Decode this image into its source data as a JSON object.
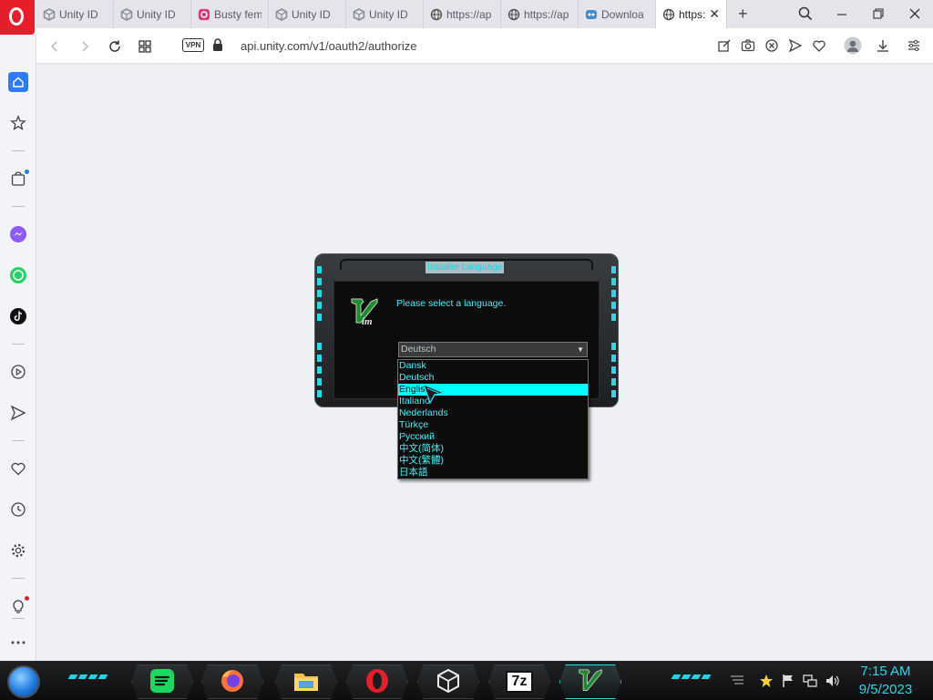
{
  "browser": {
    "tabs": [
      {
        "label": "Unity ID",
        "icon": "unity-icon"
      },
      {
        "label": "Unity ID",
        "icon": "unity-icon"
      },
      {
        "label": "Busty fem",
        "icon": "pink-app-icon"
      },
      {
        "label": "Unity ID",
        "icon": "unity-icon"
      },
      {
        "label": "Unity ID",
        "icon": "unity-icon"
      },
      {
        "label": "https://ap",
        "icon": "globe-icon"
      },
      {
        "label": "https://ap",
        "icon": "globe-icon"
      },
      {
        "label": "Downloa",
        "icon": "godot-icon"
      }
    ],
    "active_tab": {
      "label": "https:",
      "icon": "globe-icon",
      "close": "✕"
    },
    "new_tab": "+",
    "vpn_label": "VPN",
    "url": "api.unity.com/v1/oauth2/authorize",
    "accent_color": "#e61e2b"
  },
  "installer": {
    "title": "Installer Language",
    "prompt": "Please select a language.",
    "selected_value": "Deutsch",
    "dropdown_arrow": "▼",
    "options": [
      "Dansk",
      "Deutsch",
      "English",
      "Italiano",
      "Nederlands",
      "Türkçe",
      "Русский",
      "中文(简体)",
      "中文(繁體)",
      "日本語"
    ],
    "highlighted_option": "English",
    "text_color": "#3ff0f7",
    "highlight_color": "#00ffff"
  },
  "taskbar": {
    "apps": [
      "spotify-icon",
      "firefox-icon",
      "file-explorer-icon",
      "opera-icon",
      "unity-hub-icon",
      "7zip-icon",
      "vim-icon"
    ],
    "seven_zip_label": "7z",
    "time": "7:15 AM",
    "date": "9/5/2023",
    "clock_color": "#27d8ea"
  }
}
